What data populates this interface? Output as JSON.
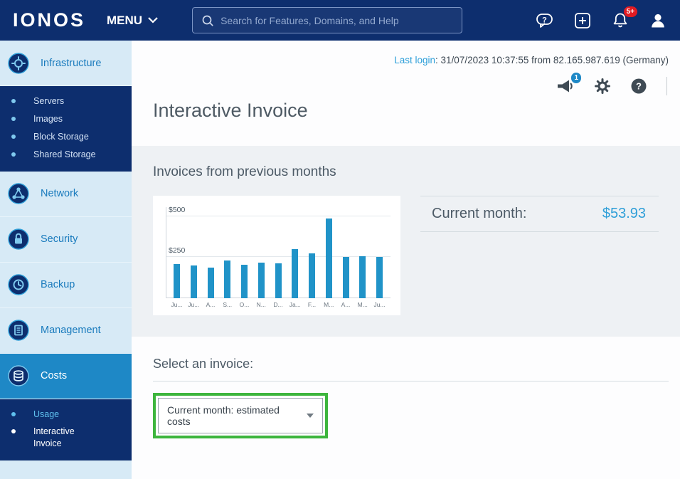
{
  "navbar": {
    "brand": "IONOS",
    "menu_label": "MENU",
    "search_placeholder": "Search for Features, Domains, and Help",
    "bell_badge": "5+"
  },
  "sidebar": {
    "items": [
      {
        "label": "Infrastructure",
        "sub": [
          {
            "label": "Servers"
          },
          {
            "label": "Images"
          },
          {
            "label": "Block Storage"
          },
          {
            "label": "Shared Storage"
          }
        ]
      },
      {
        "label": "Network"
      },
      {
        "label": "Security"
      },
      {
        "label": "Backup"
      },
      {
        "label": "Management"
      },
      {
        "label": "Costs",
        "sub": [
          {
            "label": "Usage"
          },
          {
            "label": "Interactive Invoice"
          }
        ]
      }
    ]
  },
  "header": {
    "last_login_label": "Last login",
    "last_login_value": ": 31/07/2023 10:37:55 from 82.165.987.619 (Germany)",
    "megaphone_badge": "1",
    "title": "Interactive Invoice"
  },
  "invoices_panel": {
    "heading": "Invoices from previous months",
    "current_month_label": "Current month:",
    "current_month_value": "$53.93"
  },
  "chart_data": {
    "type": "bar",
    "title": "Invoices from previous months",
    "categories": [
      "Ju...",
      "Ju...",
      "A...",
      "S...",
      "O...",
      "N...",
      "D...",
      "Ja...",
      "F...",
      "M...",
      "A...",
      "M...",
      "Ju..."
    ],
    "values": [
      210,
      200,
      190,
      230,
      205,
      220,
      215,
      300,
      275,
      490,
      255,
      260,
      255
    ],
    "xlabel": "",
    "ylabel": "",
    "ylim": [
      0,
      560
    ],
    "yticks": [
      250,
      500
    ],
    "ytick_labels": [
      "$500",
      "$250"
    ],
    "grid": true,
    "legend": false,
    "bar_color": "#2093c8"
  },
  "select_section": {
    "heading": "Select an invoice:",
    "dropdown_value": "Current month: estimated costs"
  },
  "colors": {
    "navbar_navy": "#0d2e6e",
    "sidebar_blue": "#d7eaf6",
    "active_item_blue": "#1e88c6",
    "link_blue": "#2d9fd9",
    "accent_blue": "#2f9fd8",
    "badge_red": "#e11b22",
    "annotation_green": "#3db53d"
  }
}
